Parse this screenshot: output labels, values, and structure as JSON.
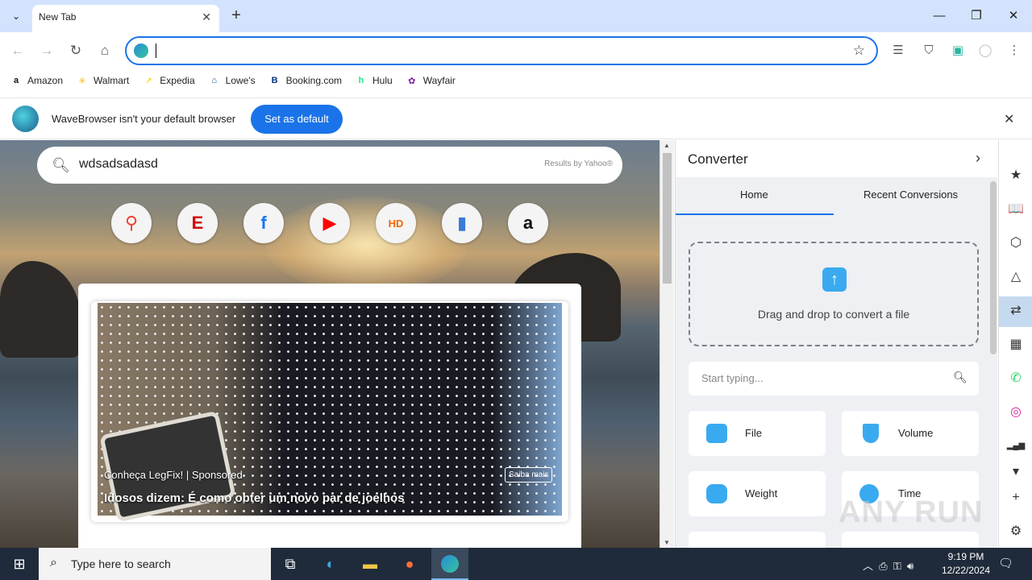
{
  "tabstrip": {
    "tab_title": "New Tab",
    "new_tab_symbol": "+",
    "tab_menu_symbol": "⌄",
    "minimize": "—",
    "restore": "❐",
    "close": "✕"
  },
  "toolbar": {
    "back": "←",
    "forward": "→",
    "reload": "↻",
    "home": "⌂",
    "address_value": "",
    "star": "☆",
    "menu": "⋮"
  },
  "bookmarks": [
    {
      "label": "Amazon",
      "icon": "amazon-icon",
      "glyph": "a",
      "color": "#111"
    },
    {
      "label": "Walmart",
      "icon": "walmart-icon",
      "glyph": "✳",
      "color": "#f5b800"
    },
    {
      "label": "Expedia",
      "icon": "expedia-icon",
      "glyph": "↗",
      "color": "#fdd835"
    },
    {
      "label": "Lowe's",
      "icon": "lowes-icon",
      "glyph": "⌂",
      "color": "#004990"
    },
    {
      "label": "Booking.com",
      "icon": "booking-icon",
      "glyph": "B",
      "color": "#003580"
    },
    {
      "label": "Hulu",
      "icon": "hulu-icon",
      "glyph": "h",
      "color": "#1ce783"
    },
    {
      "label": "Wayfair",
      "icon": "wayfair-icon",
      "glyph": "✿",
      "color": "#7b189f"
    }
  ],
  "infobar": {
    "message": "WaveBrowser isn't your default browser",
    "button": "Set as default",
    "close": "✕"
  },
  "newtab": {
    "search_value": "wdsadsadasd",
    "search_provider": "Results by Yahoo®",
    "shortcuts": [
      {
        "name": "google-maps-shortcut",
        "glyph": "⚲",
        "color": "#ea4335"
      },
      {
        "name": "espn-shortcut",
        "glyph": "E",
        "color": "#d50a0a"
      },
      {
        "name": "facebook-shortcut",
        "glyph": "f",
        "color": "#1877f2"
      },
      {
        "name": "youtube-shortcut",
        "glyph": "▶",
        "color": "#ff0000"
      },
      {
        "name": "home-depot-shortcut",
        "glyph": "HD",
        "color": "#f96302"
      },
      {
        "name": "shopping-shortcut",
        "glyph": "▮",
        "color": "#3b7bd8"
      },
      {
        "name": "amazon-shortcut",
        "glyph": "a",
        "color": "#111"
      }
    ],
    "ad": {
      "brand": "Conheça LegFix! | Sponsored",
      "cta": "Saiba mais",
      "headline": "Idosos dizem: É como obter um novo par de joelhos"
    }
  },
  "panel": {
    "title": "Converter",
    "tabs": [
      "Home",
      "Recent Conversions"
    ],
    "dropzone_text": "Drag and drop to convert a file",
    "search_placeholder": "Start typing...",
    "categories": [
      {
        "label": "File",
        "icon": "folder-icon"
      },
      {
        "label": "Volume",
        "icon": "flask-icon"
      },
      {
        "label": "Weight",
        "icon": "weight-icon"
      },
      {
        "label": "Time",
        "icon": "stopwatch-icon"
      }
    ]
  },
  "right_sidebar": [
    {
      "name": "bookmark-star-icon",
      "glyph": "★"
    },
    {
      "name": "reader-icon",
      "glyph": "📖"
    },
    {
      "name": "box-icon",
      "glyph": "⬡"
    },
    {
      "name": "shapes-icon",
      "glyph": "△"
    },
    {
      "name": "converter-icon",
      "glyph": "⇄"
    },
    {
      "name": "calendar-icon",
      "glyph": "▦"
    },
    {
      "name": "whatsapp-icon",
      "glyph": "✆"
    },
    {
      "name": "instagram-icon",
      "glyph": "◎"
    },
    {
      "name": "chart-icon",
      "glyph": "▂▄▆"
    },
    {
      "name": "chevron-down-icon",
      "glyph": "▾"
    },
    {
      "name": "add-icon",
      "glyph": "+"
    },
    {
      "name": "settings-icon",
      "glyph": "⚙"
    }
  ],
  "watermark": "ANY RUN",
  "taskbar": {
    "search_placeholder": "Type here to search",
    "time": "9:19 PM",
    "date": "12/22/2024"
  }
}
